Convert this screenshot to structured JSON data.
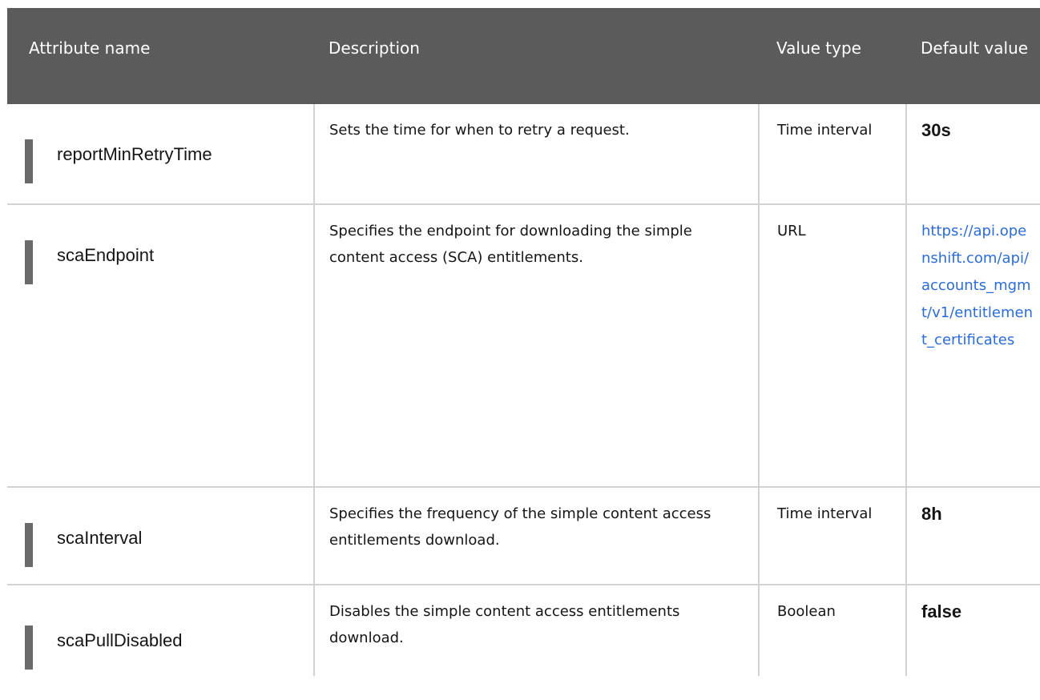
{
  "table": {
    "headers": {
      "attribute_name": "Attribute name",
      "description": "Description",
      "value_type": "Value type",
      "default_value": "Default value"
    },
    "rows": [
      {
        "attribute_name": "reportMinRetryTime",
        "description": "Sets the time for when to retry a request.",
        "value_type": "Time interval",
        "default_value": "30s"
      },
      {
        "attribute_name": "scaEndpoint",
        "description": "Specifies the endpoint for downloading the simple content access (SCA) entitlements.",
        "value_type": "URL",
        "default_value": "https://api.openshift.com/api/accounts_mgmt/v1/entitlement_certificates"
      },
      {
        "attribute_name": "scaInterval",
        "description": "Specifies the frequency of the simple content access entitlements download.",
        "value_type": "Time interval",
        "default_value": "8h"
      },
      {
        "attribute_name": "scaPullDisabled",
        "description": "Disables the simple content access entitlements download.",
        "value_type": "Boolean",
        "default_value": "false"
      }
    ]
  },
  "colors": {
    "header_background": "#5b5b5b",
    "header_text": "#ffffff",
    "link": "#2b6cd8",
    "row_border": "#d2d2d2",
    "name_bar": "#6a6a6a"
  }
}
